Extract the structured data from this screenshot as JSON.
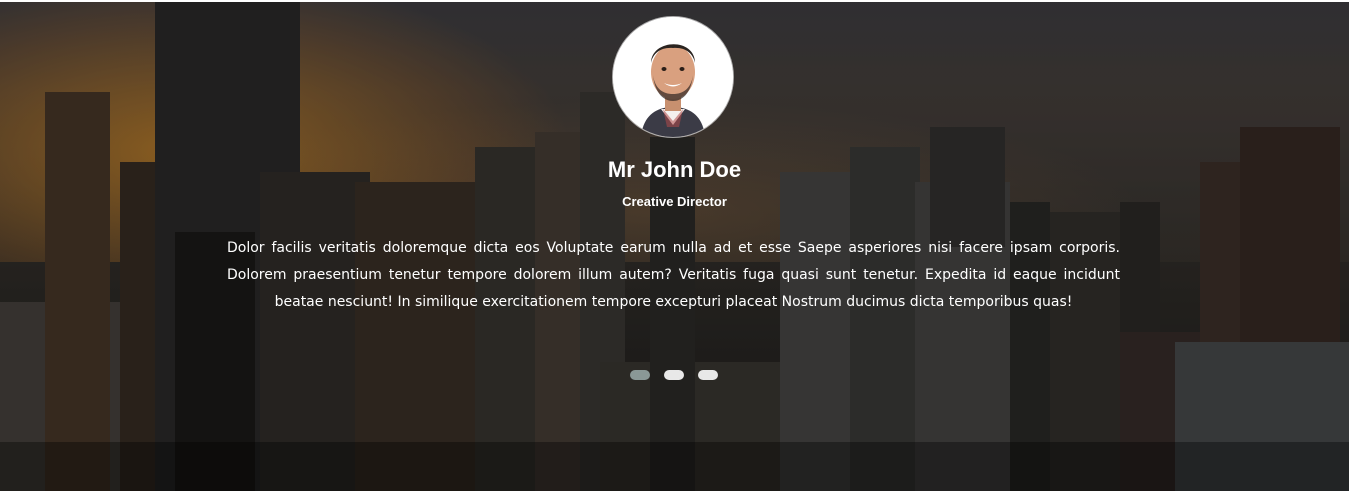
{
  "testimonial": {
    "name": "Mr John Doe",
    "role": "Creative Director",
    "quote": "Dolor facilis veritatis doloremque dicta eos Voluptate earum nulla ad et esse Saepe asperiores nisi facere ipsam corporis. Dolorem praesentium tenetur tempore dolorem illum autem? Veritatis fuga quasi sunt tenetur. Expedita id eaque incidunt beatae nesciunt! In similique exercitationem tempore excepturi placeat Nostrum ducimus dicta temporibus quas!",
    "avatar_icon": "person-portrait-icon"
  },
  "slider": {
    "total_slides": 3,
    "active_slide": 1
  },
  "colors": {
    "text": "#ffffff",
    "dot_active": "#8a9896",
    "dot_inactive": "#e8e8e8",
    "sky_glow": "#e69628"
  }
}
